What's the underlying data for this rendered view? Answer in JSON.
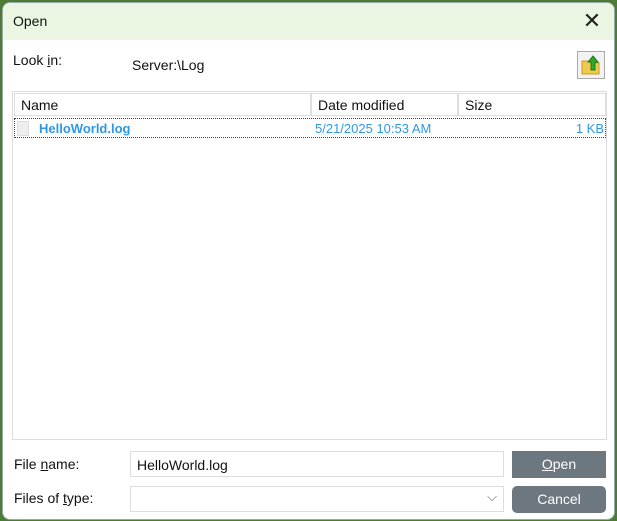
{
  "window": {
    "title": "Open",
    "close_icon": "close-icon"
  },
  "look_in": {
    "label_parts": [
      "Look ",
      "i",
      "n:"
    ],
    "value": "Server:\\Log",
    "up_button_icon": "folder-up-icon"
  },
  "columns": [
    "Name",
    "Date modified",
    "Size"
  ],
  "files": [
    {
      "name": "HelloWorld.log",
      "date": "5/21/2025 10:53 AM",
      "size": "1 KB"
    }
  ],
  "file_name": {
    "label_parts": [
      "File ",
      "n",
      "ame:"
    ],
    "value": "HelloWorld.log"
  },
  "file_type": {
    "label_parts": [
      "Files of ",
      "t",
      "ype:"
    ],
    "value": ""
  },
  "buttons": {
    "open_parts": [
      "O",
      "pen"
    ],
    "cancel": "Cancel"
  },
  "colors": {
    "selection_text": "#2e98e6",
    "button": "#6d7780",
    "titlebar": "#eaf6e2"
  }
}
